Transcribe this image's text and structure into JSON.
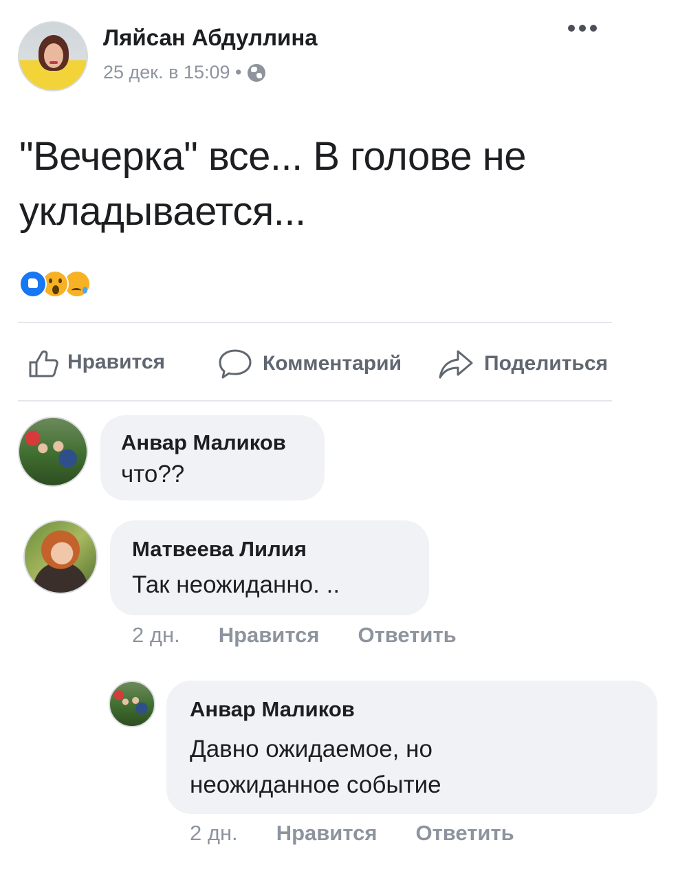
{
  "post": {
    "author": "Ляйсан Абдуллина",
    "date": "25 дек. в 15:09 •",
    "text_line1": "\"Вечерка\" все... В голове не",
    "text_line2": "укладывается..."
  },
  "reactions": [
    "like-icon",
    "wow-icon",
    "sad-icon"
  ],
  "actions": {
    "like": "Нравится",
    "comment": "Комментарий",
    "share": "Поделиться"
  },
  "comments": [
    {
      "author": "Анвар Маликов",
      "text": "что??"
    },
    {
      "author": "Матвеева Лилия",
      "text": "Так неожиданно. ..",
      "time": "2 дн.",
      "like": "Нравится",
      "reply": "Ответить"
    },
    {
      "author": "Анвар Маликов",
      "text_line1": "Давно ожидаемое, но",
      "text_line2": "неожиданное событие",
      "time": "2 дн.",
      "like": "Нравится",
      "reply": "Ответить"
    }
  ],
  "colors": {
    "text": "#1c1e21",
    "muted": "#8d949e",
    "action": "#606770",
    "bubble": "#f0f2f5",
    "like_blue": "#1877f2",
    "emoji_yellow": "#f7b125"
  }
}
